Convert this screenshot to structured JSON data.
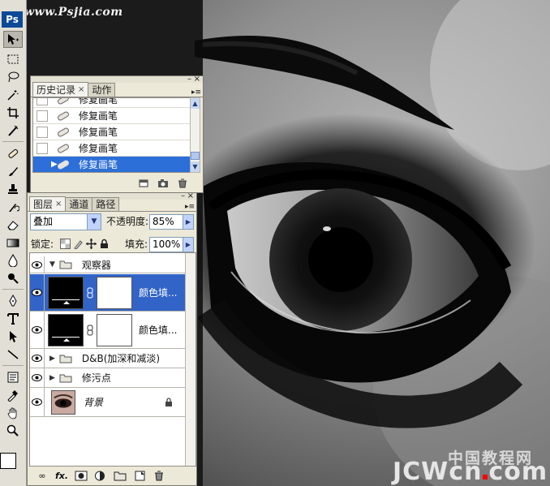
{
  "watermark": {
    "top": "www.Psjia.com",
    "bottom_cn": "中国教程网",
    "bottom_a": "JCW",
    "bottom_b": "cn",
    "bottom_c": "com"
  },
  "toolbar": {
    "logo": "Ps",
    "tools": [
      "move-tool",
      "marquee-tool",
      "lasso-tool",
      "magic-wand-tool",
      "crop-tool",
      "slice-tool",
      "healing-brush-tool",
      "brush-tool",
      "clone-stamp-tool",
      "history-brush-tool",
      "eraser-tool",
      "gradient-tool",
      "blur-tool",
      "dodge-tool",
      "pen-tool",
      "type-tool",
      "path-selection-tool",
      "line-tool",
      "notes-tool",
      "eyedropper-tool",
      "hand-tool",
      "zoom-tool"
    ],
    "foreground_color": "#ffffff",
    "background_color": "#000000"
  },
  "history_panel": {
    "tabs": [
      {
        "label": "历史记录",
        "active": true,
        "closable": true
      },
      {
        "label": "动作",
        "active": false,
        "closable": false
      }
    ],
    "items": [
      {
        "label": "修复画笔",
        "selected": false
      },
      {
        "label": "修复画笔",
        "selected": false
      },
      {
        "label": "修复画笔",
        "selected": false
      },
      {
        "label": "修复画笔",
        "selected": false
      },
      {
        "label": "修复画笔",
        "selected": true
      }
    ],
    "footer_icons": [
      "new-document-from-state-icon",
      "new-snapshot-icon",
      "delete-state-icon"
    ]
  },
  "layers_panel": {
    "tabs": [
      {
        "label": "图层",
        "active": true,
        "closable": true
      },
      {
        "label": "通道",
        "active": false,
        "closable": false
      },
      {
        "label": "路径",
        "active": false,
        "closable": false
      }
    ],
    "blend_mode": "叠加",
    "opacity_label": "不透明度:",
    "opacity_value": "85%",
    "lock_label": "锁定:",
    "fill_label": "填充:",
    "fill_value": "100%",
    "layers": [
      {
        "type": "group",
        "name": "观察器",
        "expanded": true,
        "visible": true,
        "selected": false
      },
      {
        "type": "fill",
        "name": "颜色填...",
        "visible": true,
        "selected": true
      },
      {
        "type": "fill",
        "name": "颜色填...",
        "visible": true,
        "selected": false
      },
      {
        "type": "group",
        "name": "D&B(加深和减淡)",
        "expanded": false,
        "visible": true,
        "selected": false
      },
      {
        "type": "group",
        "name": "修污点",
        "expanded": false,
        "visible": true,
        "selected": false
      },
      {
        "type": "background",
        "name": "背景",
        "visible": true,
        "selected": false,
        "locked": true
      }
    ],
    "footer_icons": [
      "link-layers-icon",
      "fx-icon",
      "add-mask-icon",
      "adjustment-layer-icon",
      "new-group-icon",
      "new-layer-icon",
      "delete-layer-icon"
    ],
    "footer_fx": "fx."
  }
}
